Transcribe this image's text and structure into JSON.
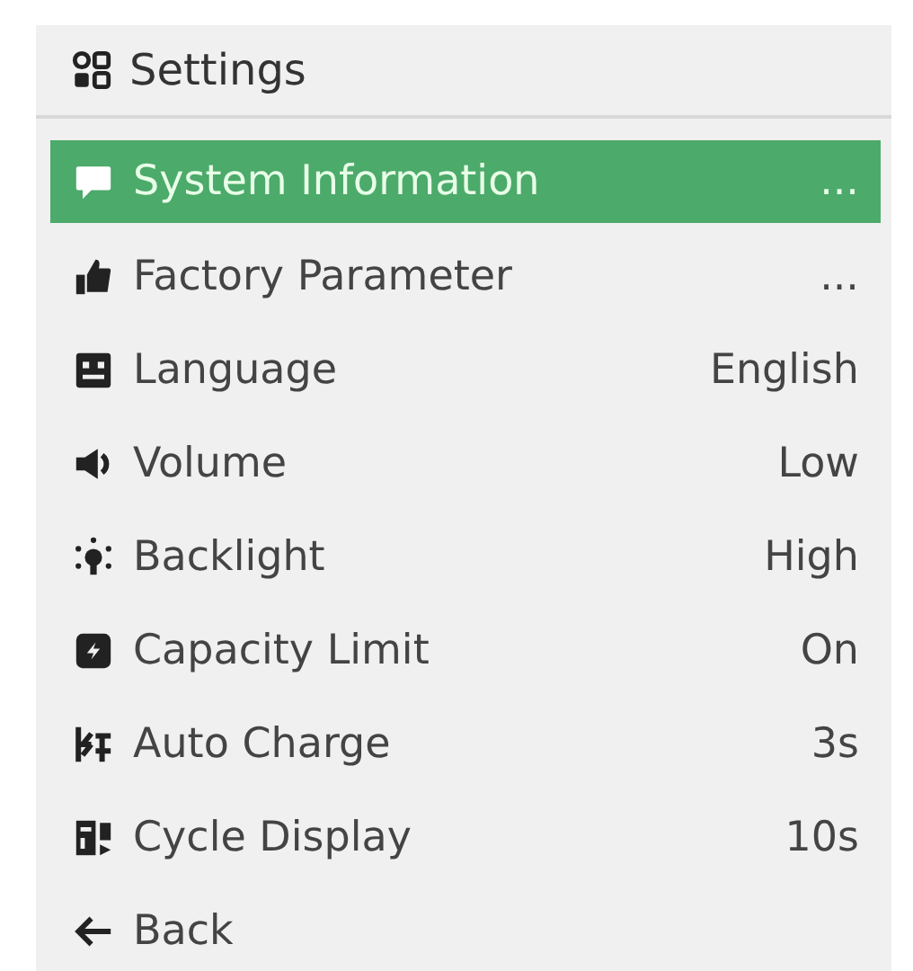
{
  "header": {
    "title": "Settings"
  },
  "items": [
    {
      "label": "System Information",
      "value": "...",
      "selected": true
    },
    {
      "label": "Factory Parameter",
      "value": "...",
      "selected": false
    },
    {
      "label": "Language",
      "value": "English",
      "selected": false
    },
    {
      "label": "Volume",
      "value": "Low",
      "selected": false
    },
    {
      "label": "Backlight",
      "value": "High",
      "selected": false
    },
    {
      "label": "Capacity Limit",
      "value": "On",
      "selected": false
    },
    {
      "label": "Auto Charge",
      "value": "3s",
      "selected": false
    },
    {
      "label": "Cycle Display",
      "value": "10s",
      "selected": false
    },
    {
      "label": "Back",
      "selected": false
    }
  ]
}
